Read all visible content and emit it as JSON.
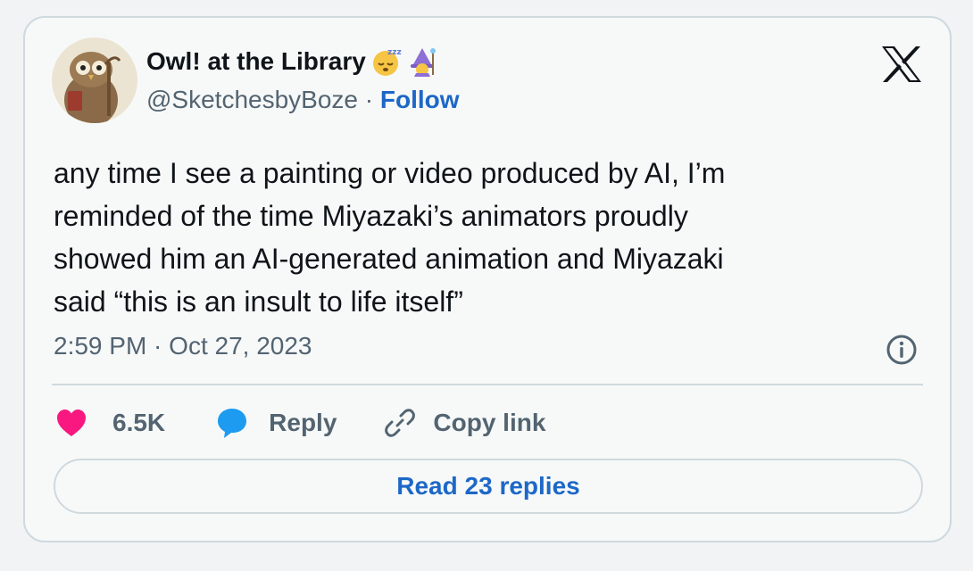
{
  "author": {
    "display_name": "Owl! at the Library",
    "handle": "@SketchesbyBoze",
    "separator": "·",
    "follow_label": "Follow",
    "emoji_icons": [
      "sleeping-face-icon",
      "mage-icon"
    ]
  },
  "tweet": {
    "text": "any time I see a painting or video produced by AI, I’m\nreminded of the time Miyazaki’s animators proudly\nshowed him an AI-generated animation and Miyazaki\nsaid “this is an insult to life itself”",
    "timestamp": "2:59 PM · Oct 27, 2023"
  },
  "actions": {
    "like_count": "6.5K",
    "reply_label": "Reply",
    "copy_link_label": "Copy link"
  },
  "read_replies_label": "Read 23 replies",
  "colors": {
    "link_blue": "#1d68c7",
    "heart_pink": "#f91880",
    "reply_blue": "#1d9bf0",
    "secondary_text": "#536471",
    "border": "#cfd9de"
  }
}
